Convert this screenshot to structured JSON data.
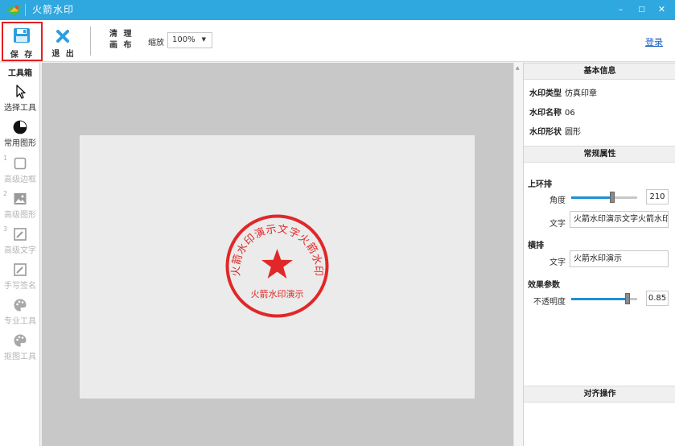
{
  "titlebar": {
    "title": "火箭水印",
    "minimize": "–",
    "maximize": "□",
    "close": "✕"
  },
  "toolbar": {
    "save_label": "保 存",
    "exit_label": "退 出",
    "clear_line1": "清 理",
    "clear_line2": "画 布",
    "zoom_label": "缩放",
    "zoom_value": "100%",
    "login_label": "登录"
  },
  "toolbox": {
    "title": "工具箱",
    "tools": [
      {
        "label": "选择工具",
        "icon": "cursor-icon",
        "enabled": true,
        "num": ""
      },
      {
        "label": "常用图形",
        "icon": "shape-icon",
        "enabled": true,
        "num": ""
      },
      {
        "label": "高级边框",
        "icon": "border-icon",
        "enabled": false,
        "num": "1"
      },
      {
        "label": "高级图形",
        "icon": "image-icon",
        "enabled": false,
        "num": "2"
      },
      {
        "label": "高级文字",
        "icon": "text-edit-icon",
        "enabled": false,
        "num": "3"
      },
      {
        "label": "手写签名",
        "icon": "signature-icon",
        "enabled": false,
        "num": ""
      },
      {
        "label": "专业工具",
        "icon": "palette-icon",
        "enabled": false,
        "num": ""
      },
      {
        "label": "抠图工具",
        "icon": "palette-icon",
        "enabled": false,
        "num": ""
      }
    ]
  },
  "stamp": {
    "arc_text": "火箭水印演示文字火箭水印",
    "bottom_text": "火箭水印演示",
    "color": "#e02828"
  },
  "panel": {
    "basic_info_title": "基本信息",
    "info": [
      {
        "key": "水印类型",
        "value": "仿真印章"
      },
      {
        "key": "水印名称",
        "value": "06"
      },
      {
        "key": "水印形状",
        "value": "圆形"
      }
    ],
    "props_title": "常规属性",
    "upper_arc": {
      "title": "上环排",
      "angle_label": "角度",
      "angle_value": "210",
      "angle_fraction": 0.62,
      "text_label": "文字",
      "text_value": "火箭水印演示文字火箭水印"
    },
    "horizontal": {
      "title": "横排",
      "text_label": "文字",
      "text_value": "火箭水印演示"
    },
    "effect": {
      "title": "效果参数",
      "opacity_label": "不透明度",
      "opacity_value": "0.85",
      "opacity_fraction": 0.85
    },
    "align_title": "对齐操作"
  },
  "colors": {
    "titlebar": "#2fa7df",
    "accent": "#1e8fd8",
    "save_highlight": "#e02020"
  }
}
